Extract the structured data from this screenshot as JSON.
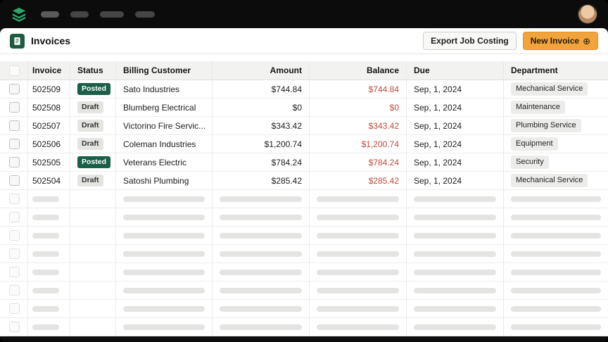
{
  "topbar": {
    "nav_placeholders": 4
  },
  "header": {
    "title": "Invoices",
    "export_button_label": "Export Job Costing",
    "new_invoice_label": "New Invoice",
    "new_invoice_icon": "⊕"
  },
  "table": {
    "columns": {
      "invoice": "Invoice",
      "status": "Status",
      "customer": "Billing Customer",
      "amount": "Amount",
      "balance": "Balance",
      "due": "Due",
      "department": "Department"
    },
    "rows": [
      {
        "invoice": "502509",
        "status": "Posted",
        "customer": "Sato Industries",
        "amount": "$744.84",
        "balance": "$744.84",
        "due": "Sep, 1, 2024",
        "department": "Mechanical Service"
      },
      {
        "invoice": "502508",
        "status": "Draft",
        "customer": "Blumberg Electrical",
        "amount": "$0",
        "balance": "$0",
        "due": "Sep, 1, 2024",
        "department": "Maintenance"
      },
      {
        "invoice": "502507",
        "status": "Draft",
        "customer": "Victorino Fire Servic...",
        "amount": "$343.42",
        "balance": "$343.42",
        "due": "Sep, 1, 2024",
        "department": "Plumbing Service"
      },
      {
        "invoice": "502506",
        "status": "Draft",
        "customer": "Coleman Industries",
        "amount": "$1,200.74",
        "balance": "$1,200.74",
        "due": "Sep, 1, 2024",
        "department": "Equipment"
      },
      {
        "invoice": "502505",
        "status": "Posted",
        "customer": "Veterans Electric",
        "amount": "$784.24",
        "balance": "$784.24",
        "due": "Sep, 1, 2024",
        "department": "Security"
      },
      {
        "invoice": "502504",
        "status": "Draft",
        "customer": "Satoshi Plumbing",
        "amount": "$285.42",
        "balance": "$285.42",
        "due": "Sep, 1, 2024",
        "department": "Mechanical Service"
      }
    ],
    "skeleton_rows": 8
  },
  "colors": {
    "brand_green": "#2da56a",
    "accent_amber": "#f2a43c",
    "balance_red": "#c24a3a",
    "posted_green": "#1a5f48"
  }
}
